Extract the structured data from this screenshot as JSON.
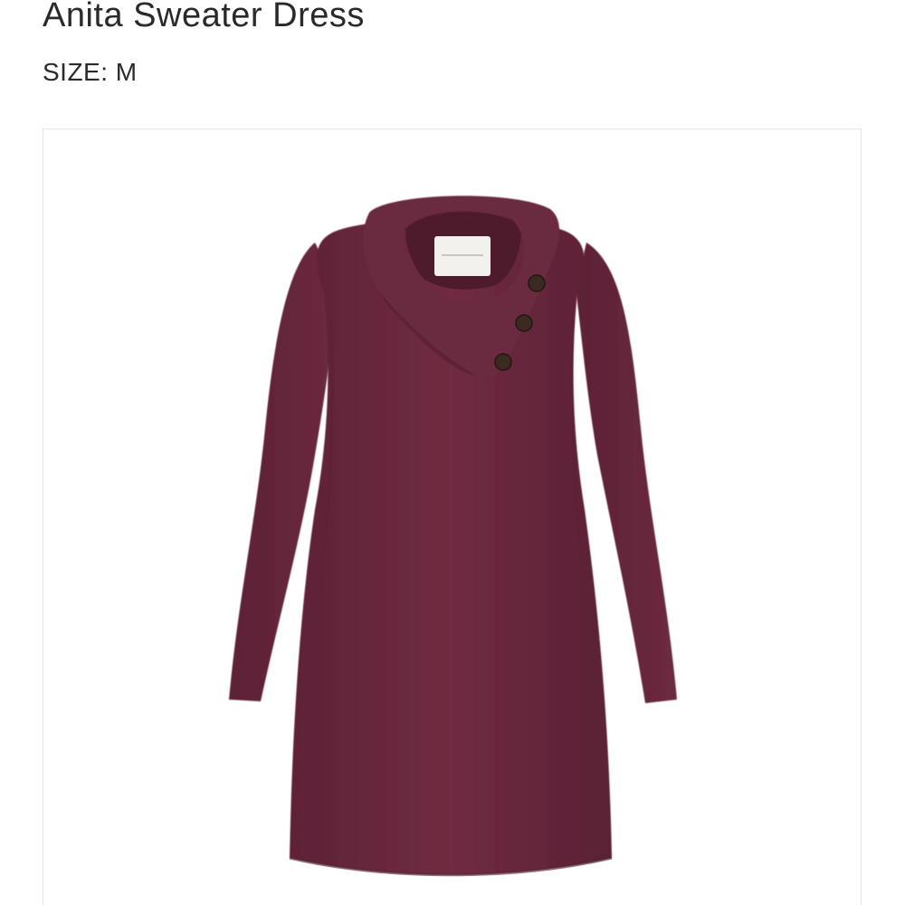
{
  "product": {
    "name": "Anita Sweater Dress",
    "size_label": "SIZE:",
    "size_value": "M"
  },
  "image": {
    "subject": "dress-image",
    "garment_color": "#6b2a3e",
    "button_color": "#3b2a22"
  }
}
